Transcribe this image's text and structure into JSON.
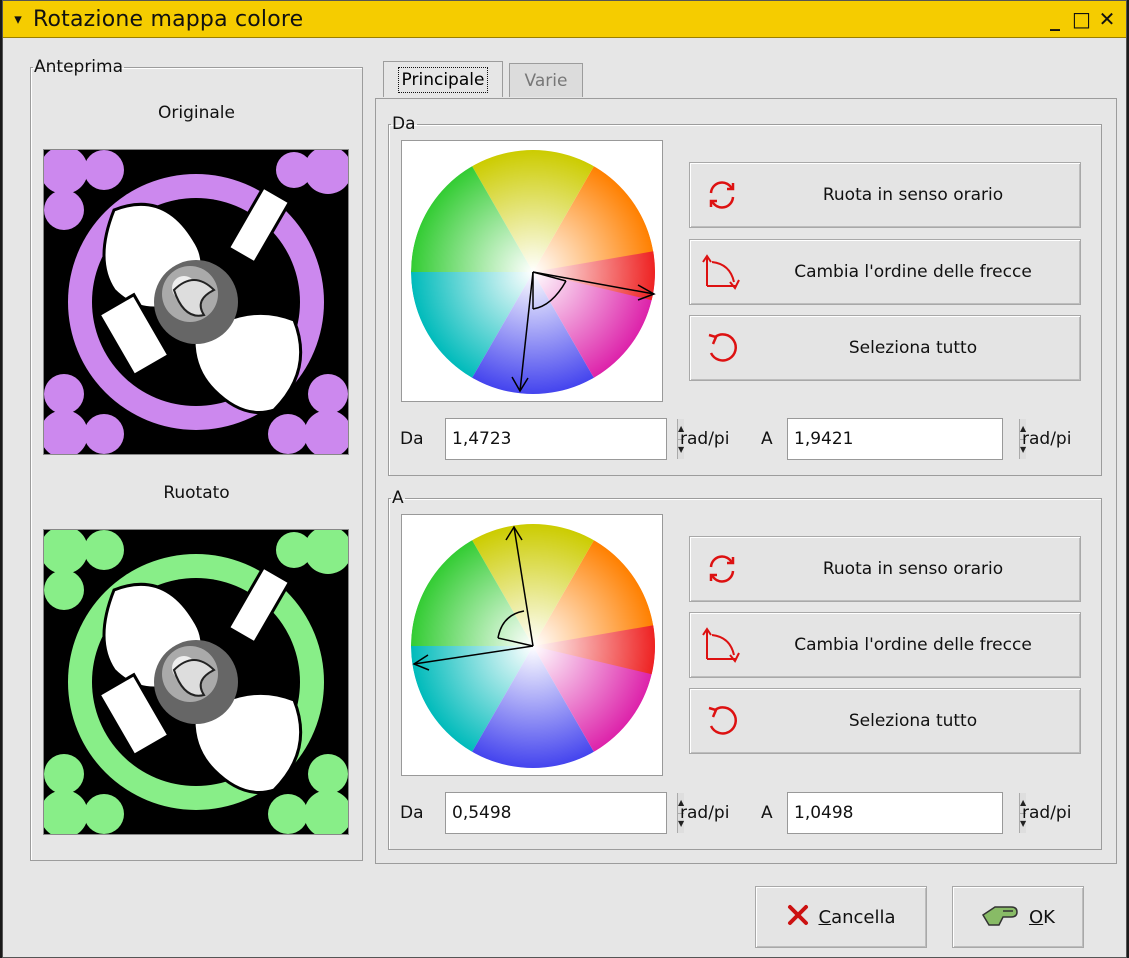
{
  "window": {
    "title": "Rotazione mappa colore",
    "menu_glyph": "▾",
    "minimize_glyph": "_",
    "maximize_glyph": "□",
    "close_glyph": "✕",
    "titlebar_color": "#f5cc00"
  },
  "preview": {
    "legend": "Anteprima",
    "original_label": "Originale",
    "rotated_label": "Ruotato",
    "original_accent": "#cc88ee",
    "rotated_accent": "#88ee88"
  },
  "tabs": [
    {
      "label": "Principale",
      "active": true
    },
    {
      "label": "Varie",
      "active": false
    }
  ],
  "from_group": {
    "legend": "Da",
    "buttons": {
      "rotate": "Ruota in senso orario",
      "swap": "Cambia l'ordine delle frecce",
      "select_all": "Seleziona tutto"
    },
    "from_label": "Da",
    "from_value": "1,4723",
    "from_unit": "rad/pi",
    "to_label": "A",
    "to_value": "1,9421",
    "to_unit": "rad/pi"
  },
  "to_group": {
    "legend": "A",
    "buttons": {
      "rotate": "Ruota in senso orario",
      "swap": "Cambia l'ordine delle frecce",
      "select_all": "Seleziona tutto"
    },
    "from_label": "Da",
    "from_value": "0,5498",
    "from_unit": "rad/pi",
    "to_label": "A",
    "to_value": "1,0498",
    "to_unit": "rad/pi"
  },
  "footer": {
    "cancel_prefix": "C",
    "cancel_rest": "ancella",
    "ok_prefix": "O",
    "ok_rest": "K"
  },
  "icons": {
    "rotate": "rotate-clockwise-icon",
    "swap": "swap-arrows-icon",
    "select_all": "select-all-icon",
    "cancel": "cancel-x-icon",
    "ok": "ok-hand-icon"
  },
  "accent_icon_color": "#dd1111"
}
